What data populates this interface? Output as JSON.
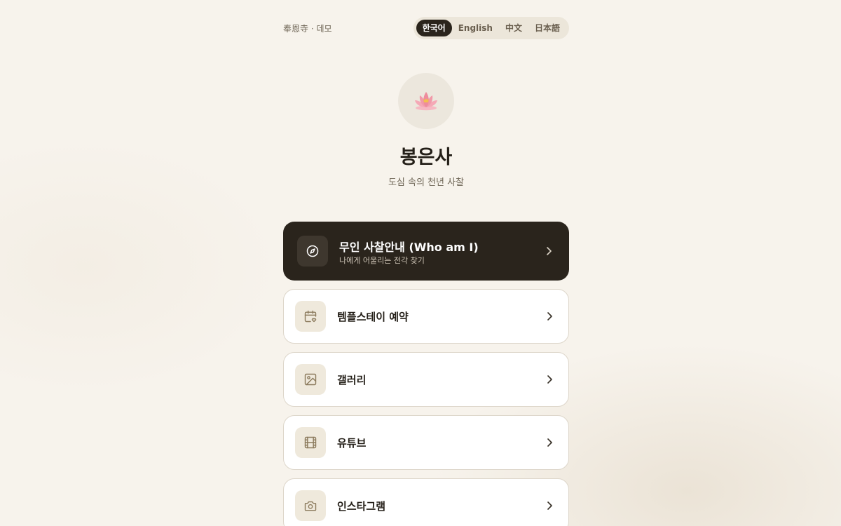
{
  "header": {
    "brand": "奉恩寺 · 데모",
    "languages": [
      {
        "label": "한국어",
        "active": true
      },
      {
        "label": "English",
        "active": false
      },
      {
        "label": "中文",
        "active": false
      },
      {
        "label": "日本語",
        "active": false
      }
    ]
  },
  "hero": {
    "logo_icon": "lotus-icon",
    "title": "봉은사",
    "subtitle": "도심 속의 천년 사찰"
  },
  "menu": [
    {
      "title": "무인 사찰안내 (Who am I)",
      "subtitle": "나에게 어울리는 전각 찾기",
      "icon": "compass-icon",
      "style": "dark"
    },
    {
      "title": "템플스테이 예약",
      "icon": "calendar-heart-icon",
      "style": "light"
    },
    {
      "title": "갤러리",
      "icon": "image-icon",
      "style": "light"
    },
    {
      "title": "유튜브",
      "icon": "film-icon",
      "style": "light"
    },
    {
      "title": "인스타그램",
      "icon": "camera-icon",
      "style": "light"
    }
  ],
  "colors": {
    "background": "#f7f3ec",
    "primary_dark": "#2a241c",
    "icon_accent": "#8b7a5c",
    "lotus_pink": "#f19aa9"
  }
}
